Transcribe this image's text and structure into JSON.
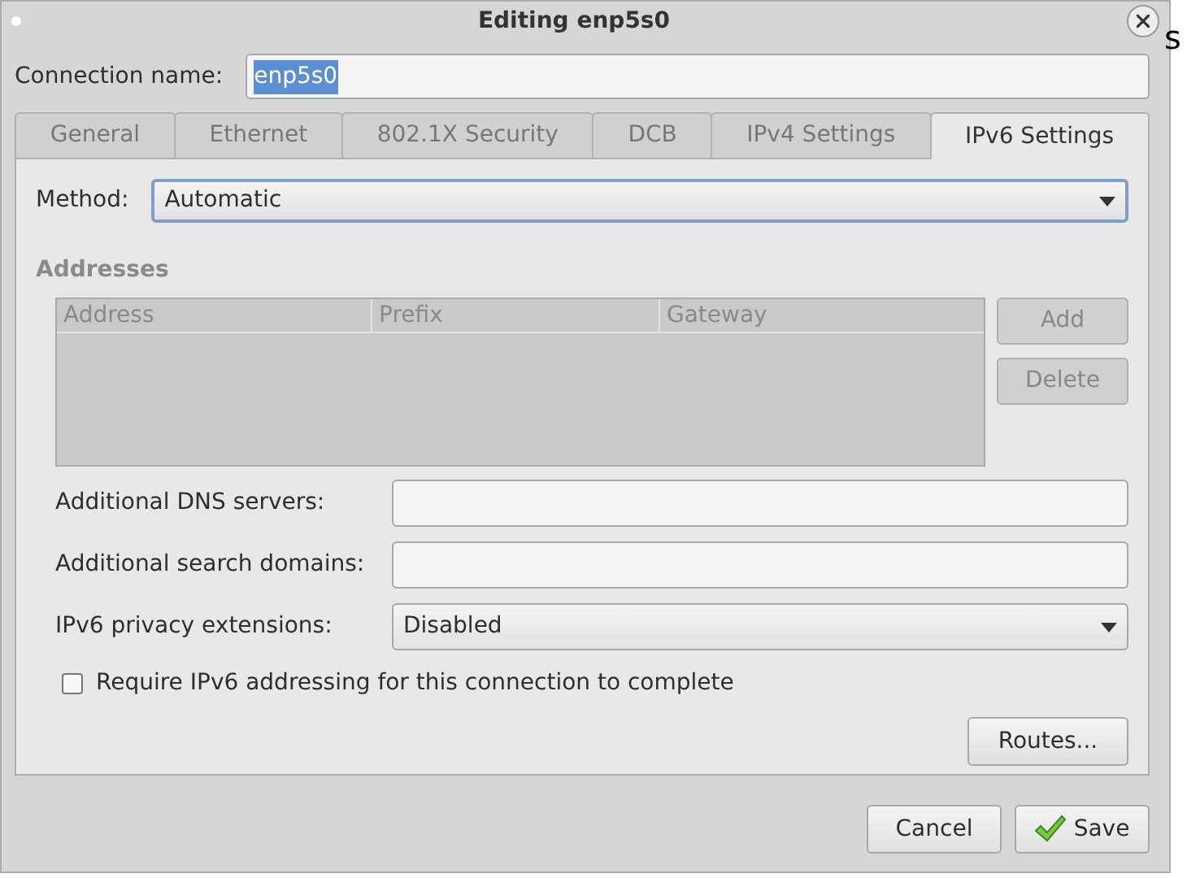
{
  "window": {
    "title": "Editing enp5s0"
  },
  "connection_name": {
    "label": "Connection name:",
    "value": "enp5s0",
    "selected": true
  },
  "tabs": [
    {
      "label": "General",
      "selected": false
    },
    {
      "label": "Ethernet",
      "selected": false
    },
    {
      "label": "802.1X Security",
      "selected": false
    },
    {
      "label": "DCB",
      "selected": false
    },
    {
      "label": "IPv4 Settings",
      "selected": false
    },
    {
      "label": "IPv6 Settings",
      "selected": true
    }
  ],
  "method": {
    "label": "Method:",
    "value": "Automatic",
    "focused": true
  },
  "addresses": {
    "heading": "Addresses",
    "disabled": true,
    "columns": [
      "Address",
      "Prefix",
      "Gateway"
    ],
    "buttons": [
      {
        "label": "Add",
        "disabled": true
      },
      {
        "label": "Delete",
        "disabled": true
      }
    ]
  },
  "fields": [
    {
      "kind": "text",
      "label": "Additional DNS servers:"
    },
    {
      "kind": "text",
      "label": "Additional search domains:"
    },
    {
      "kind": "select",
      "label": "IPv6 privacy extensions:",
      "value": "Disabled"
    }
  ],
  "checkbox": {
    "label": "Require IPv6 addressing for this connection to complete",
    "checked": false
  },
  "routes_button": "Routes...",
  "buttons": [
    {
      "kind": "plain",
      "label": "Cancel"
    },
    {
      "kind": "save",
      "label": "Save"
    }
  ],
  "background_text": "s"
}
